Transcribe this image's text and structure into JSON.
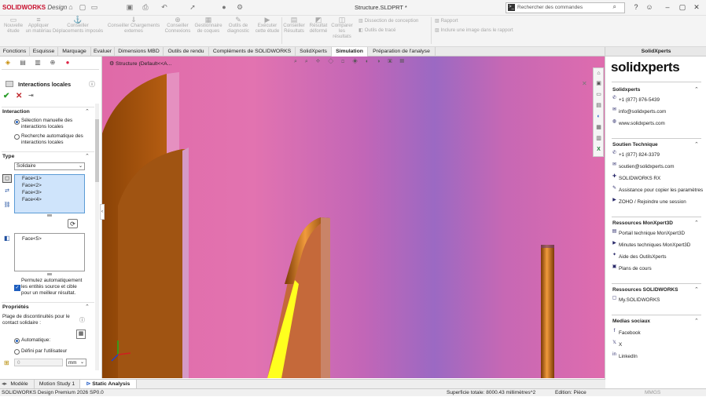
{
  "app": {
    "logo_bold": "SOLIDWORKS",
    "logo_rest": "Design",
    "document_title": "Structure.SLDPRT *",
    "search_placeholder": "Rechercher des commandes"
  },
  "quick_icons": [
    "home-icon",
    "new-icon",
    "open-icon",
    "save-icon",
    "print-icon",
    "undo-icon",
    "select-icon",
    "rebuild-icon",
    "options-icon"
  ],
  "window_icons": [
    "help-icon",
    "user-icon",
    "minimize-icon",
    "restore-icon",
    "close-icon"
  ],
  "ribbon": {
    "big": [
      {
        "label": "Nouvelle étude",
        "name": "new-study-button"
      },
      {
        "label": "Appliquer un matériau",
        "name": "apply-material-button"
      },
      {
        "label": "Conseiller Déplacements imposés",
        "name": "fixtures-advisor-button"
      },
      {
        "label": "Conseiller Chargements externes",
        "name": "external-loads-button"
      },
      {
        "label": "Conseiller Connexions",
        "name": "connections-advisor-button"
      },
      {
        "label": "Gestionnaire de coques",
        "name": "shell-manager-button"
      },
      {
        "label": "Outils de diagnostic",
        "name": "diagnostic-tools-button"
      },
      {
        "label": "Exécuter cette étude",
        "name": "run-study-button"
      },
      {
        "label": "Conseiller Résultats",
        "name": "results-advisor-button"
      },
      {
        "label": "Résultat déformé",
        "name": "deformed-result-button"
      },
      {
        "label": "Comparer les résultats",
        "name": "compare-results-button"
      }
    ],
    "small": [
      {
        "label": "Dissection de conception",
        "name": "design-dissection-button"
      },
      {
        "label": "Outils de tracé",
        "name": "plot-tools-button"
      },
      {
        "label": "Rapport",
        "name": "report-button"
      },
      {
        "label": "Inclure une image dans le rapport",
        "name": "include-image-button"
      }
    ]
  },
  "tabs": [
    "Fonctions",
    "Esquisse",
    "Marquage",
    "Evaluer",
    "Dimensions MBD",
    "Outils de rendu",
    "Compléments de SOLIDWORKS",
    "SolidXperts",
    "Simulation",
    "Préparation de l'analyse"
  ],
  "active_tab": "Simulation",
  "viewport": {
    "tree_label": "Structure (Default<<A..."
  },
  "property_manager": {
    "title": "Interactions locales",
    "section_interaction": "Interaction",
    "radio_manual": "Sélection manuelle des interactions locales",
    "radio_auto": "Recherche automatique des interactions locales",
    "section_type": "Type",
    "type_value": "Solidaire",
    "faces_source": [
      "Face<1>",
      "Face<2>",
      "Face<3>",
      "Face<4>"
    ],
    "faces_target": [
      "Face<5>"
    ],
    "checkbox_label": "Permutez automatiquement les entités source et cible pour un meilleur résultat.",
    "section_props": "Propriétés",
    "gap_label": "Plage de discontinuités pour le contact solidaire :",
    "radio_automatic": "Automatique:",
    "radio_user": "Défini par l'utilisateur",
    "unit": "mm",
    "gap_value": "0"
  },
  "right_panel": {
    "header": "SolidXperts",
    "logo_main": "solidx",
    "logo_accent": "perts",
    "sections": [
      {
        "title": "Solidxperts",
        "items": [
          "+1 (877) 876-5439",
          "info@solidxperts.com",
          "www.solidxperts.com"
        ]
      },
      {
        "title": "Soutien Technique",
        "items": [
          "+1 (877) 824-3379",
          "soutien@solidxperts.com",
          "SOLIDWORKS RX",
          "Assistance pour copier les paramètres",
          "ZOHO / Rejoindre une session"
        ]
      },
      {
        "title": "Ressources MonXpert3D",
        "items": [
          "Portail technique MonXpert3D",
          "Minutes techniques MonXpert3D",
          "Aide des OutilsXperts",
          "Plans de cours"
        ]
      },
      {
        "title": "Ressources SOLIDWORKS",
        "items": [
          "My.SOLIDWORKS"
        ]
      },
      {
        "title": "Medias sociaux",
        "items": [
          "Facebook",
          "X",
          "LinkedIn"
        ]
      }
    ]
  },
  "bottom_tabs": [
    "Modèle",
    "Motion Study 1",
    "Static Analysis"
  ],
  "status": {
    "product": "SOLIDWORKS Design Premium 2026 SP0.0",
    "area": "Superficie totale: 8000.43 millimètres^2",
    "edition": "Edition: Pièce",
    "units": "MMGS"
  }
}
